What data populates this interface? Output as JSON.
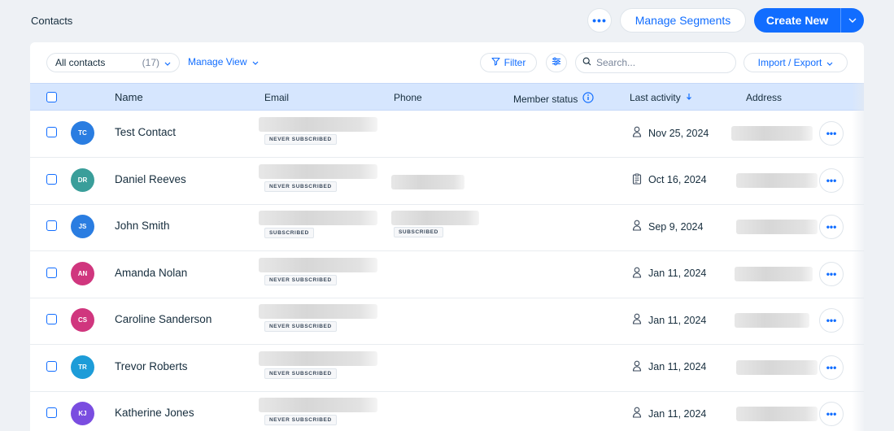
{
  "header": {
    "title": "Contacts",
    "more_label": "•••",
    "manage_segments_label": "Manage Segments",
    "create_new_label": "Create New"
  },
  "toolbar": {
    "view_label": "All contacts",
    "view_count": "(17)",
    "manage_view_label": "Manage View",
    "filter_label": "Filter",
    "search_placeholder": "Search...",
    "import_export_label": "Import / Export"
  },
  "table": {
    "columns": {
      "name": "Name",
      "email": "Email",
      "phone": "Phone",
      "member_status": "Member status",
      "last_activity": "Last activity",
      "address": "Address"
    },
    "rows": [
      {
        "initials": "TC",
        "avatar_color": "#2a7de1",
        "name": "Test Contact",
        "email_status": "NEVER SUBSCRIBED",
        "phone_status": "",
        "activity_icon": "person-icon",
        "last_activity": "Nov 25, 2024"
      },
      {
        "initials": "DR",
        "avatar_color": "#3a9e9a",
        "name": "Daniel Reeves",
        "email_status": "NEVER SUBSCRIBED",
        "phone_status": "",
        "activity_icon": "clipboard-icon",
        "last_activity": "Oct 16, 2024"
      },
      {
        "initials": "JS",
        "avatar_color": "#2a7de1",
        "name": "John Smith",
        "email_status": "SUBSCRIBED",
        "phone_status": "SUBSCRIBED",
        "activity_icon": "person-icon",
        "last_activity": "Sep 9, 2024"
      },
      {
        "initials": "AN",
        "avatar_color": "#d0367e",
        "name": "Amanda Nolan",
        "email_status": "NEVER SUBSCRIBED",
        "phone_status": "",
        "activity_icon": "person-icon",
        "last_activity": "Jan 11, 2024"
      },
      {
        "initials": "CS",
        "avatar_color": "#d0367e",
        "name": "Caroline Sanderson",
        "email_status": "NEVER SUBSCRIBED",
        "phone_status": "",
        "activity_icon": "person-icon",
        "last_activity": "Jan 11, 2024"
      },
      {
        "initials": "TR",
        "avatar_color": "#1d9cd8",
        "name": "Trevor Roberts",
        "email_status": "NEVER SUBSCRIBED",
        "phone_status": "",
        "activity_icon": "person-icon",
        "last_activity": "Jan 11, 2024"
      },
      {
        "initials": "KJ",
        "avatar_color": "#7a4de0",
        "name": "Katherine Jones",
        "email_status": "NEVER SUBSCRIBED",
        "phone_status": "",
        "activity_icon": "person-icon",
        "last_activity": "Jan 11, 2024"
      }
    ]
  },
  "colors": {
    "accent": "#116dff",
    "header_row": "#d6e6fe"
  }
}
